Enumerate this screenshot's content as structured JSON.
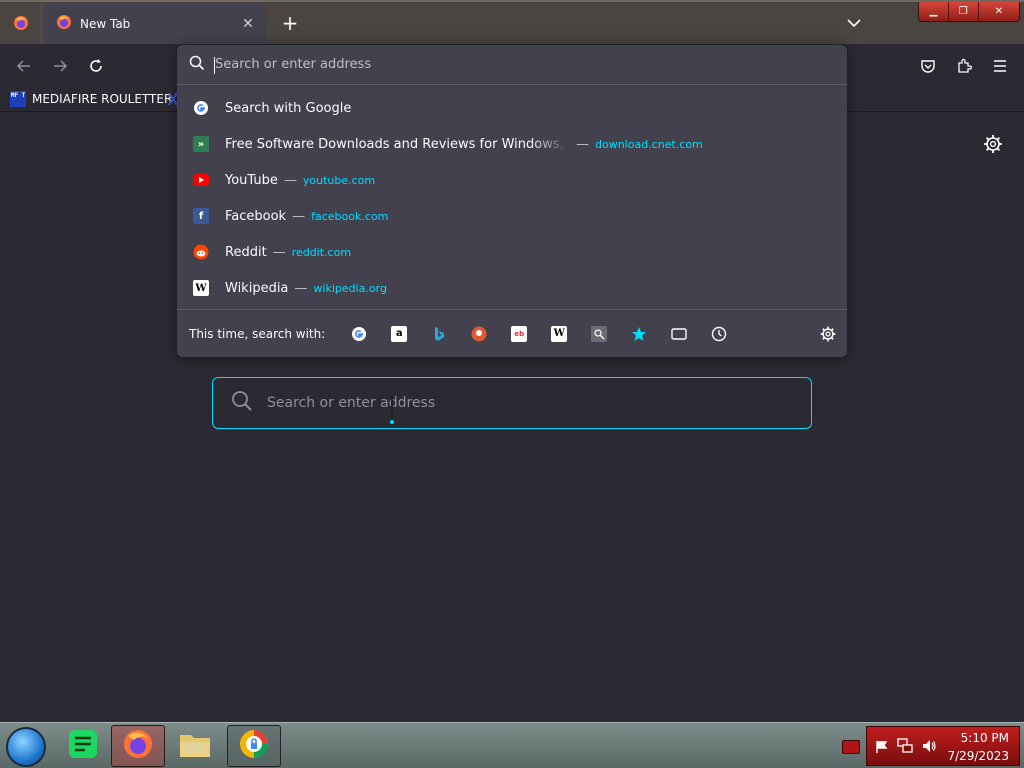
{
  "browser": {
    "tab": {
      "title": "New Tab",
      "close_label": "✕"
    },
    "new_tab_label": "+",
    "window_controls": {
      "minimize": "▁",
      "restore": "❐",
      "close": "✕"
    }
  },
  "bookmarks": [
    {
      "label": "MEDIAFIRE ROULETTER",
      "icon_text": "MF T"
    }
  ],
  "urlbar": {
    "placeholder": "Search or enter address",
    "results": [
      {
        "title": "Search with Google",
        "url": "",
        "icon": "google-icon"
      },
      {
        "title": "Free Software Downloads and Reviews for Windows, Android",
        "url": "download.cnet.com",
        "icon": "cnet-download-icon"
      },
      {
        "title": "YouTube",
        "url": "youtube.com",
        "icon": "youtube-icon"
      },
      {
        "title": "Facebook",
        "url": "facebook.com",
        "icon": "facebook-icon"
      },
      {
        "title": "Reddit",
        "url": "reddit.com",
        "icon": "reddit-icon"
      },
      {
        "title": "Wikipedia",
        "url": "wikipedia.org",
        "icon": "wikipedia-icon"
      }
    ],
    "separator": "—",
    "oneoff_label": "This time, search with:",
    "engines": [
      "google",
      "amazon",
      "bing",
      "duckduckgo",
      "ebay",
      "wikipedia",
      "search-shortcut",
      "bookmarks",
      "tabs",
      "history"
    ]
  },
  "newtab": {
    "search_placeholder": "Search or enter address"
  },
  "taskbar": {
    "time": "5:10 PM",
    "date": "7/29/2023"
  },
  "colors": {
    "accent": "#00ddff",
    "panel": "#42414d",
    "background": "#2b2a33"
  }
}
